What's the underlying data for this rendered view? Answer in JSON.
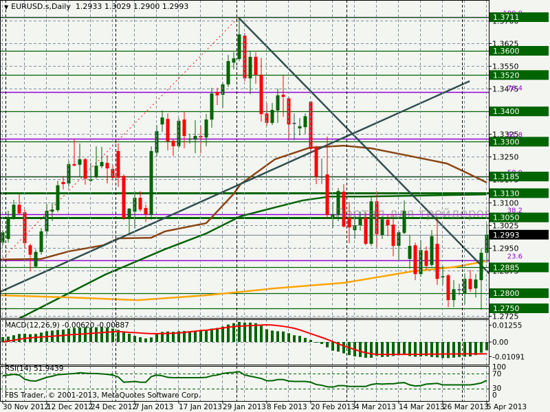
{
  "header": {
    "symbol": "EURUSD.s,Daily",
    "ohlc": "1.2933 1.3029 1.2900 1.2993"
  },
  "watermark": "Портал для трейдеров - ForTrader.ru",
  "copyright": "FBS Trader, © 2001-2013, MetaQuotes Software Corp.",
  "macd_label": "MACD(12,26,9) -0.00620 -0.00887",
  "rsi_label": "RSI(14) 51.9439",
  "colors": {
    "bull": "#006400",
    "bear": "#ff0000",
    "doji": "#2f4f4f",
    "level": "#006400",
    "fib": "#9400d3",
    "ma_fast": "#8b4513",
    "ma_mid": "#006400",
    "ma_slow": "#ffa500",
    "trend": "#2f4f4f",
    "signal": "#ff0000",
    "background": "#f3f5f1"
  },
  "chart_data": {
    "type": "candlestick",
    "title": "EURUSD.s,Daily",
    "ylim": [
      1.268,
      1.38
    ],
    "price_ticks": [
      "1.3700",
      "1.3625",
      "1.3550",
      "1.3475",
      "1.3400",
      "1.3325",
      "1.3250",
      "1.3175",
      "1.3100",
      "1.3025",
      "1.2950",
      "1.2875",
      "1.2800",
      "1.2725"
    ],
    "date_labels": [
      {
        "index": 0,
        "label": "30 Nov 2012"
      },
      {
        "index": 8,
        "label": "12 Dec 2012"
      },
      {
        "index": 16,
        "label": "24 Dec 2012"
      },
      {
        "index": 24,
        "label": "7 Jan 2013"
      },
      {
        "index": 32,
        "label": "17 Jan 2013"
      },
      {
        "index": 40,
        "label": "29 Jan 2013"
      },
      {
        "index": 48,
        "label": "8 Feb 2013"
      },
      {
        "index": 56,
        "label": "20 Feb 2013"
      },
      {
        "index": 64,
        "label": "4 Mar 2013"
      },
      {
        "index": 72,
        "label": "14 Mar 2013"
      },
      {
        "index": 80,
        "label": "26 Mar 2013"
      },
      {
        "index": 88,
        "label": "5 Apr 2013"
      }
    ],
    "month_separators": [
      1,
      21,
      43,
      63,
      84
    ],
    "ohlc": [
      [
        1.2967,
        1.3008,
        1.2958,
        1.3001
      ],
      [
        1.2979,
        1.3072,
        1.2967,
        1.3049
      ],
      [
        1.3049,
        1.3108,
        1.3042,
        1.3092
      ],
      [
        1.3092,
        1.3126,
        1.3058,
        1.3063
      ],
      [
        1.3067,
        1.3076,
        1.2947,
        1.2965
      ],
      [
        1.2958,
        1.2963,
        1.2872,
        1.2927
      ],
      [
        1.2888,
        1.2945,
        1.2883,
        1.2936
      ],
      [
        1.2936,
        1.3015,
        1.2927,
        1.3004
      ],
      [
        1.3004,
        1.3094,
        1.2992,
        1.3072
      ],
      [
        1.3069,
        1.3099,
        1.3038,
        1.3076
      ],
      [
        1.3074,
        1.3171,
        1.3067,
        1.3156
      ],
      [
        1.3167,
        1.3187,
        1.3142,
        1.316
      ],
      [
        1.3162,
        1.3237,
        1.3151,
        1.3226
      ],
      [
        1.3226,
        1.3307,
        1.3219,
        1.3221
      ],
      [
        1.3224,
        1.3294,
        1.3185,
        1.3242
      ],
      [
        1.3242,
        1.3246,
        1.3158,
        1.3178
      ],
      [
        1.3171,
        1.323,
        1.3167,
        1.3176
      ],
      [
        1.3183,
        1.3285,
        1.3178,
        1.3221
      ],
      [
        1.3219,
        1.3283,
        1.3212,
        1.3233
      ],
      [
        1.323,
        1.3255,
        1.3162,
        1.3212
      ],
      [
        1.321,
        1.3224,
        1.3171,
        1.3181
      ],
      [
        1.3269,
        1.3294,
        1.3151,
        1.3181
      ],
      [
        1.3187,
        1.3192,
        1.3042,
        1.3047
      ],
      [
        1.3047,
        1.3081,
        1.2997,
        1.3079
      ],
      [
        1.3069,
        1.3137,
        1.3013,
        1.3115
      ],
      [
        1.3115,
        1.3137,
        1.3069,
        1.3076
      ],
      [
        1.3081,
        1.3092,
        1.3035,
        1.306
      ],
      [
        1.3058,
        1.3285,
        1.3042,
        1.3269
      ],
      [
        1.3264,
        1.3355,
        1.3251,
        1.3335
      ],
      [
        1.3357,
        1.3403,
        1.3332,
        1.338
      ],
      [
        1.3375,
        1.3393,
        1.3271,
        1.3301
      ],
      [
        1.3303,
        1.3307,
        1.3253,
        1.3285
      ],
      [
        1.3285,
        1.3378,
        1.3278,
        1.3369
      ],
      [
        1.3373,
        1.3398,
        1.3278,
        1.3319
      ],
      [
        1.3307,
        1.3326,
        1.3294,
        1.331
      ],
      [
        1.3307,
        1.3371,
        1.3262,
        1.3319
      ],
      [
        1.3319,
        1.3353,
        1.3262,
        1.3314
      ],
      [
        1.3314,
        1.3391,
        1.3285,
        1.3373
      ],
      [
        1.3373,
        1.3478,
        1.3346,
        1.3459
      ],
      [
        1.3464,
        1.3478,
        1.3421,
        1.3453
      ],
      [
        1.3455,
        1.3496,
        1.3412,
        1.3489
      ],
      [
        1.3489,
        1.3586,
        1.348,
        1.3566
      ],
      [
        1.3561,
        1.3595,
        1.3539,
        1.3575
      ],
      [
        1.3573,
        1.3711,
        1.3566,
        1.3654
      ],
      [
        1.365,
        1.3659,
        1.35,
        1.3509
      ],
      [
        1.3509,
        1.36,
        1.3457,
        1.358
      ],
      [
        1.358,
        1.3595,
        1.3491,
        1.3521
      ],
      [
        1.3521,
        1.3577,
        1.3366,
        1.3391
      ],
      [
        1.3393,
        1.3428,
        1.3351,
        1.3362
      ],
      [
        1.3362,
        1.3428,
        1.3355,
        1.3405
      ],
      [
        1.3403,
        1.3475,
        1.3362,
        1.3453
      ],
      [
        1.3455,
        1.3521,
        1.3382,
        1.3448
      ],
      [
        1.3443,
        1.3448,
        1.331,
        1.3357
      ],
      [
        1.3362,
        1.3393,
        1.3305,
        1.3362
      ],
      [
        1.3344,
        1.3378,
        1.3321,
        1.3351
      ],
      [
        1.3348,
        1.3393,
        1.3326,
        1.3384
      ],
      [
        1.3432,
        1.3434,
        1.3264,
        1.3276
      ],
      [
        1.328,
        1.3287,
        1.316,
        1.3185
      ],
      [
        1.3185,
        1.3244,
        1.316,
        1.3185
      ],
      [
        1.3192,
        1.3317,
        1.3047,
        1.3058
      ],
      [
        1.3051,
        1.3101,
        1.3015,
        1.306
      ],
      [
        1.3058,
        1.3147,
        1.3038,
        1.3137
      ],
      [
        1.3135,
        1.316,
        1.3017,
        1.302
      ],
      [
        1.3049,
        1.3101,
        1.2965,
        1.3017
      ],
      [
        1.3008,
        1.3054,
        1.2979,
        1.3024
      ],
      [
        1.3024,
        1.3069,
        1.3006,
        1.3049
      ],
      [
        1.3049,
        1.3067,
        1.2958,
        1.2963
      ],
      [
        1.2963,
        1.3117,
        1.2956,
        1.3103
      ],
      [
        1.3103,
        1.3137,
        1.2952,
        1.2995
      ],
      [
        1.2992,
        1.3054,
        1.2979,
        1.3044
      ],
      [
        1.3042,
        1.306,
        1.2988,
        1.3024
      ],
      [
        1.3026,
        1.306,
        1.2922,
        1.2956
      ],
      [
        1.2956,
        1.3008,
        1.2906,
        1.3001
      ],
      [
        1.2999,
        1.3106,
        1.2995,
        1.3072
      ],
      [
        1.2913,
        1.2992,
        1.2881,
        1.2956
      ],
      [
        1.2958,
        1.2967,
        1.2843,
        1.2863
      ],
      [
        1.2863,
        1.2976,
        1.2854,
        1.2942
      ],
      [
        1.294,
        1.2954,
        1.2877,
        1.289
      ],
      [
        1.2893,
        1.3008,
        1.2888,
        1.2988
      ],
      [
        1.2963,
        1.3049,
        1.2827,
        1.2847
      ],
      [
        1.2852,
        1.289,
        1.2827,
        1.2856
      ],
      [
        1.2859,
        1.2863,
        1.2754,
        1.2777
      ],
      [
        1.2777,
        1.2843,
        1.2754,
        1.2813
      ],
      [
        1.2813,
        1.2831,
        1.2793,
        1.2813
      ],
      [
        1.28,
        1.2865,
        1.2763,
        1.2847
      ],
      [
        1.2847,
        1.2877,
        1.2804,
        1.2813
      ],
      [
        1.2816,
        1.2863,
        1.2786,
        1.2845
      ],
      [
        1.2843,
        1.2947,
        1.2745,
        1.2933
      ],
      [
        1.2933,
        1.3029,
        1.29,
        1.2993
      ]
    ],
    "levels": [
      {
        "price": 1.3711,
        "label": "1.3711",
        "thick": false
      },
      {
        "price": 1.36,
        "label": "1.3600",
        "thick": false
      },
      {
        "price": 1.352,
        "label": "1.3520",
        "thick": false
      },
      {
        "price": 1.34,
        "label": "1.3400",
        "thick": false
      },
      {
        "price": 1.33,
        "label": "1.3300",
        "thick": false
      },
      {
        "price": 1.3185,
        "label": "1.3185",
        "thick": false
      },
      {
        "price": 1.313,
        "label": "1.3130",
        "thick": true
      },
      {
        "price": 1.305,
        "label": "1.3050",
        "thick": true
      },
      {
        "price": 1.2885,
        "label": "1.2885",
        "thick": false
      },
      {
        "price": 1.28,
        "label": "1.2800",
        "thick": false
      },
      {
        "price": 1.275,
        "label": "1.2750",
        "thick": false
      }
    ],
    "current_price": {
      "price": 1.2993,
      "label": "1.2993"
    },
    "fibonacci": {
      "from": {
        "index": -0.5,
        "price": 1.2906
      },
      "to": {
        "index": 42.9,
        "price": 1.3711
      },
      "levels": [
        {
          "price": 1.3711,
          "label": "100.0"
        },
        {
          "price": 1.3463,
          "label": "76.4"
        },
        {
          "price": 1.331,
          "label": "61.8"
        },
        {
          "price": 1.3186,
          "label": "50.0"
        },
        {
          "price": 1.3061,
          "label": "38.2"
        },
        {
          "price": 1.2908,
          "label": "23.6"
        }
      ]
    },
    "trendlines": [
      {
        "name": "rising-trendline",
        "from": {
          "index": -0.5,
          "price": 1.2804
        },
        "to": {
          "index": 84.9,
          "price": 1.35
        }
      },
      {
        "name": "falling-trendline",
        "from": {
          "index": 42.9,
          "price": 1.3709
        },
        "to": {
          "index": 92.6,
          "price": 1.2788
        }
      }
    ],
    "moving_averages": [
      {
        "name": "ma-brown",
        "color_key": "ma_fast",
        "points": [
          [
            -0.5,
            1.2911
          ],
          [
            7,
            1.2913
          ],
          [
            12,
            1.2938
          ],
          [
            18.25,
            1.2958
          ],
          [
            21,
            1.2981
          ],
          [
            27,
            1.2983
          ],
          [
            29.5,
            1.3004
          ],
          [
            37,
            1.3031
          ],
          [
            42,
            1.3128
          ],
          [
            43.25,
            1.316
          ],
          [
            49.5,
            1.3242
          ],
          [
            55.75,
            1.328
          ],
          [
            62,
            1.3287
          ],
          [
            67,
            1.3278
          ],
          [
            74.5,
            1.3251
          ],
          [
            80.75,
            1.3228
          ],
          [
            84.5,
            1.3196
          ],
          [
            88,
            1.3165
          ]
        ]
      },
      {
        "name": "ma-green",
        "color_key": "ma_mid",
        "points": [
          [
            -0.5,
            1.2684
          ],
          [
            18.6,
            1.2861
          ],
          [
            29.5,
            1.2945
          ],
          [
            37,
            1.2997
          ],
          [
            43.25,
            1.3054
          ],
          [
            49.5,
            1.3083
          ],
          [
            54.5,
            1.3106
          ],
          [
            59.5,
            1.3119
          ],
          [
            65.75,
            1.3119
          ],
          [
            88,
            1.3126
          ]
        ]
      },
      {
        "name": "ma-orange",
        "color_key": "ma_slow",
        "points": [
          [
            -0.5,
            1.2793
          ],
          [
            12,
            1.2786
          ],
          [
            24.5,
            1.2777
          ],
          [
            37,
            1.2793
          ],
          [
            49.5,
            1.2816
          ],
          [
            62,
            1.2834
          ],
          [
            74.5,
            1.2872
          ],
          [
            82,
            1.2886
          ],
          [
            88,
            1.2906
          ]
        ]
      }
    ],
    "macd": {
      "params": "12,26,9",
      "ylim": [
        -0.0164,
        0.0164
      ],
      "axis_labels": [
        "0.01255",
        "0.00",
        "-0.01091"
      ],
      "axis_values": [
        0.01255,
        0.0,
        -0.01091
      ],
      "histogram": [
        0.0036,
        0.004,
        0.005,
        0.006,
        0.0062,
        0.0058,
        0.006,
        0.007,
        0.008,
        0.0085,
        0.009,
        0.0092,
        0.01,
        0.0105,
        0.0108,
        0.011,
        0.0108,
        0.011,
        0.011,
        0.0108,
        0.01,
        0.009,
        0.0075,
        0.0062,
        0.0045,
        0.0035,
        0.0026,
        0.0034,
        0.0062,
        0.0075,
        0.0078,
        0.0076,
        0.008,
        0.0082,
        0.008,
        0.0082,
        0.0085,
        0.009,
        0.01,
        0.0105,
        0.0115,
        0.013,
        0.014,
        0.015,
        0.0145,
        0.0145,
        0.014,
        0.012,
        0.0095,
        0.0085,
        0.008,
        0.0078,
        0.0065,
        0.005,
        0.0045,
        0.003,
        0.0015,
        -0.0003,
        -0.0015,
        -0.004,
        -0.0065,
        -0.0072,
        -0.0085,
        -0.0098,
        -0.0108,
        -0.0112,
        -0.0118,
        -0.0118,
        -0.0105,
        -0.0112,
        -0.011,
        -0.0105,
        -0.01,
        -0.0088,
        -0.0105,
        -0.011,
        -0.0108,
        -0.0105,
        -0.0112,
        -0.0115,
        -0.012,
        -0.012,
        -0.0117,
        -0.0112,
        -0.011,
        -0.0108,
        -0.0098,
        -0.008,
        -0.0062
      ],
      "signal": [
        0.0,
        0.0007,
        0.0013,
        0.002,
        0.0027,
        0.0031,
        0.0034,
        0.0037,
        0.004,
        0.0043,
        0.0046,
        0.0049,
        0.0053,
        0.0056,
        0.0058,
        0.0061,
        0.0064,
        0.0067,
        0.007,
        0.0073,
        0.0076,
        0.0077,
        0.0075,
        0.0072,
        0.007,
        0.0067,
        0.0064,
        0.0062,
        0.0062,
        0.0063,
        0.0064,
        0.0065,
        0.0067,
        0.0071,
        0.0076,
        0.008,
        0.0085,
        0.0088,
        0.0093,
        0.0099,
        0.0104,
        0.011,
        0.0115,
        0.0118,
        0.012,
        0.0122,
        0.0124,
        0.0126,
        0.0128,
        0.0126,
        0.0122,
        0.0117,
        0.011,
        0.0102,
        0.009,
        0.0076,
        0.0062,
        0.0048,
        0.0034,
        0.0019,
        0.0003,
        -0.0013,
        -0.003,
        -0.0043,
        -0.0057,
        -0.007,
        -0.0081,
        -0.0088,
        -0.0092,
        -0.0093,
        -0.0093,
        -0.0093,
        -0.0093,
        -0.0093,
        -0.0092,
        -0.0092,
        -0.0092,
        -0.0091,
        -0.0091,
        -0.0091,
        -0.009,
        -0.009,
        -0.009,
        -0.009,
        -0.0089,
        -0.0089,
        -0.0089,
        -0.0089,
        -0.00887
      ]
    },
    "rsi": {
      "period": 14,
      "ylim": [
        0,
        100
      ],
      "axis_labels": [
        "100",
        "70",
        "30",
        "0"
      ],
      "levels": [
        70,
        30
      ],
      "values": [
        64,
        66,
        68,
        66,
        55,
        51,
        50,
        55,
        60,
        63,
        67,
        68,
        69,
        70,
        72,
        71,
        70,
        70,
        69,
        68,
        66,
        61,
        47,
        48,
        49,
        47,
        47,
        62,
        66,
        64,
        60,
        59,
        59,
        59,
        59,
        59,
        59,
        60,
        64,
        66,
        70,
        72,
        73,
        75,
        66,
        63,
        60,
        57,
        51,
        51,
        54,
        54,
        50,
        49,
        49,
        49,
        47,
        41,
        39,
        35,
        34,
        38,
        38,
        36,
        36,
        36,
        36,
        41,
        43,
        42,
        43,
        43,
        45,
        46,
        40,
        37,
        38,
        42,
        43,
        44,
        40,
        40,
        40,
        40,
        40,
        40,
        42,
        45,
        51.9439
      ]
    }
  }
}
